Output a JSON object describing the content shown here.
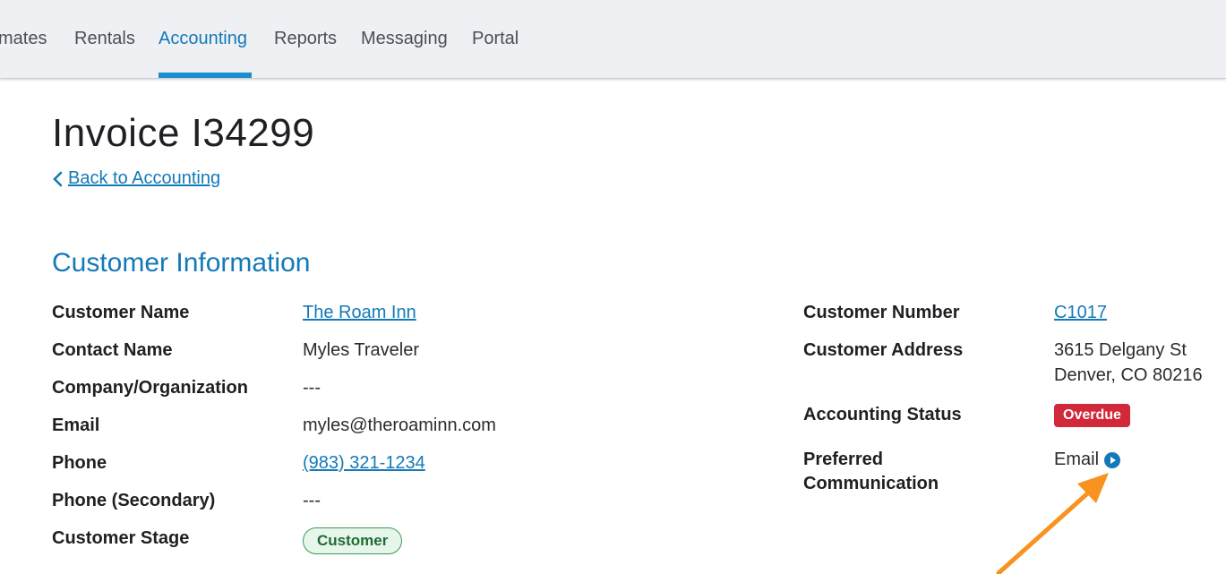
{
  "nav": {
    "items": [
      "mates",
      "Rentals",
      "Accounting",
      "Reports",
      "Messaging",
      "Portal"
    ],
    "active": "Accounting"
  },
  "page": {
    "title": "Invoice I34299",
    "back_link": "Back to Accounting"
  },
  "section": {
    "title": "Customer Information"
  },
  "left_fields": [
    {
      "label": "Customer Name",
      "value": "The Roam Inn"
    },
    {
      "label": "Contact Name",
      "value": "Myles Traveler"
    },
    {
      "label": "Company/Organization",
      "value": "---"
    },
    {
      "label": "Email",
      "value": "myles@theroaminn.com"
    },
    {
      "label": "Phone",
      "value": "(983) 321-1234"
    },
    {
      "label": "Phone (Secondary)",
      "value": "---"
    },
    {
      "label": "Customer Stage",
      "value": "Customer"
    }
  ],
  "right_fields": {
    "customer_number": {
      "label": "Customer Number",
      "value": "C1017"
    },
    "customer_address": {
      "label": "Customer Address",
      "line1": "3615 Delgany St",
      "line2": "Denver, CO 80216"
    },
    "accounting_status": {
      "label": "Accounting Status",
      "value": "Overdue"
    },
    "preferred_communication": {
      "label_line1": "Preferred",
      "label_line2": "Communication",
      "value": "Email"
    }
  },
  "icons": {
    "back": "chevron-left-icon",
    "preferred_action": "play-circle-icon",
    "annotation": "arrow-annotation"
  },
  "colors": {
    "accent": "#1479b8",
    "overdue": "#d1283a",
    "stage_bg": "#e6f6ea",
    "annotation_arrow": "#f7931e"
  }
}
